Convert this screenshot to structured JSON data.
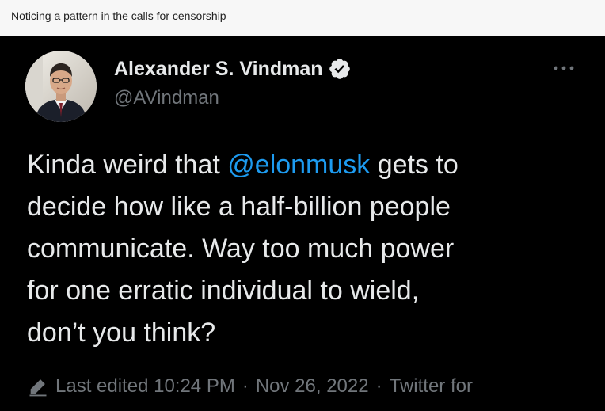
{
  "caption": "Noticing a pattern in the calls for censorship",
  "tweet": {
    "display_name": "Alexander S. Vindman",
    "handle": "@AVindman",
    "verified": true,
    "text_lines": [
      {
        "before": "Kinda weird that ",
        "mention": "@elonmusk",
        "after": " gets to"
      },
      "decide how like a half-billion people",
      "communicate. Way too much power",
      "for one erratic individual to wield,",
      "don’t you think?"
    ],
    "meta": {
      "edited_label": "Last edited 10:24 PM",
      "separator": "·",
      "date": "Nov 26, 2022",
      "source": "Twitter for"
    }
  },
  "colors": {
    "background": "#000000",
    "text": "#e7e9ea",
    "secondary_text": "#71767b",
    "mention": "#1d9bf0",
    "caption_bar": "#f7f7f7"
  },
  "icons": {
    "verified": "verified-badge-icon",
    "more": "more-horizontal-icon",
    "edited": "pencil-icon"
  }
}
